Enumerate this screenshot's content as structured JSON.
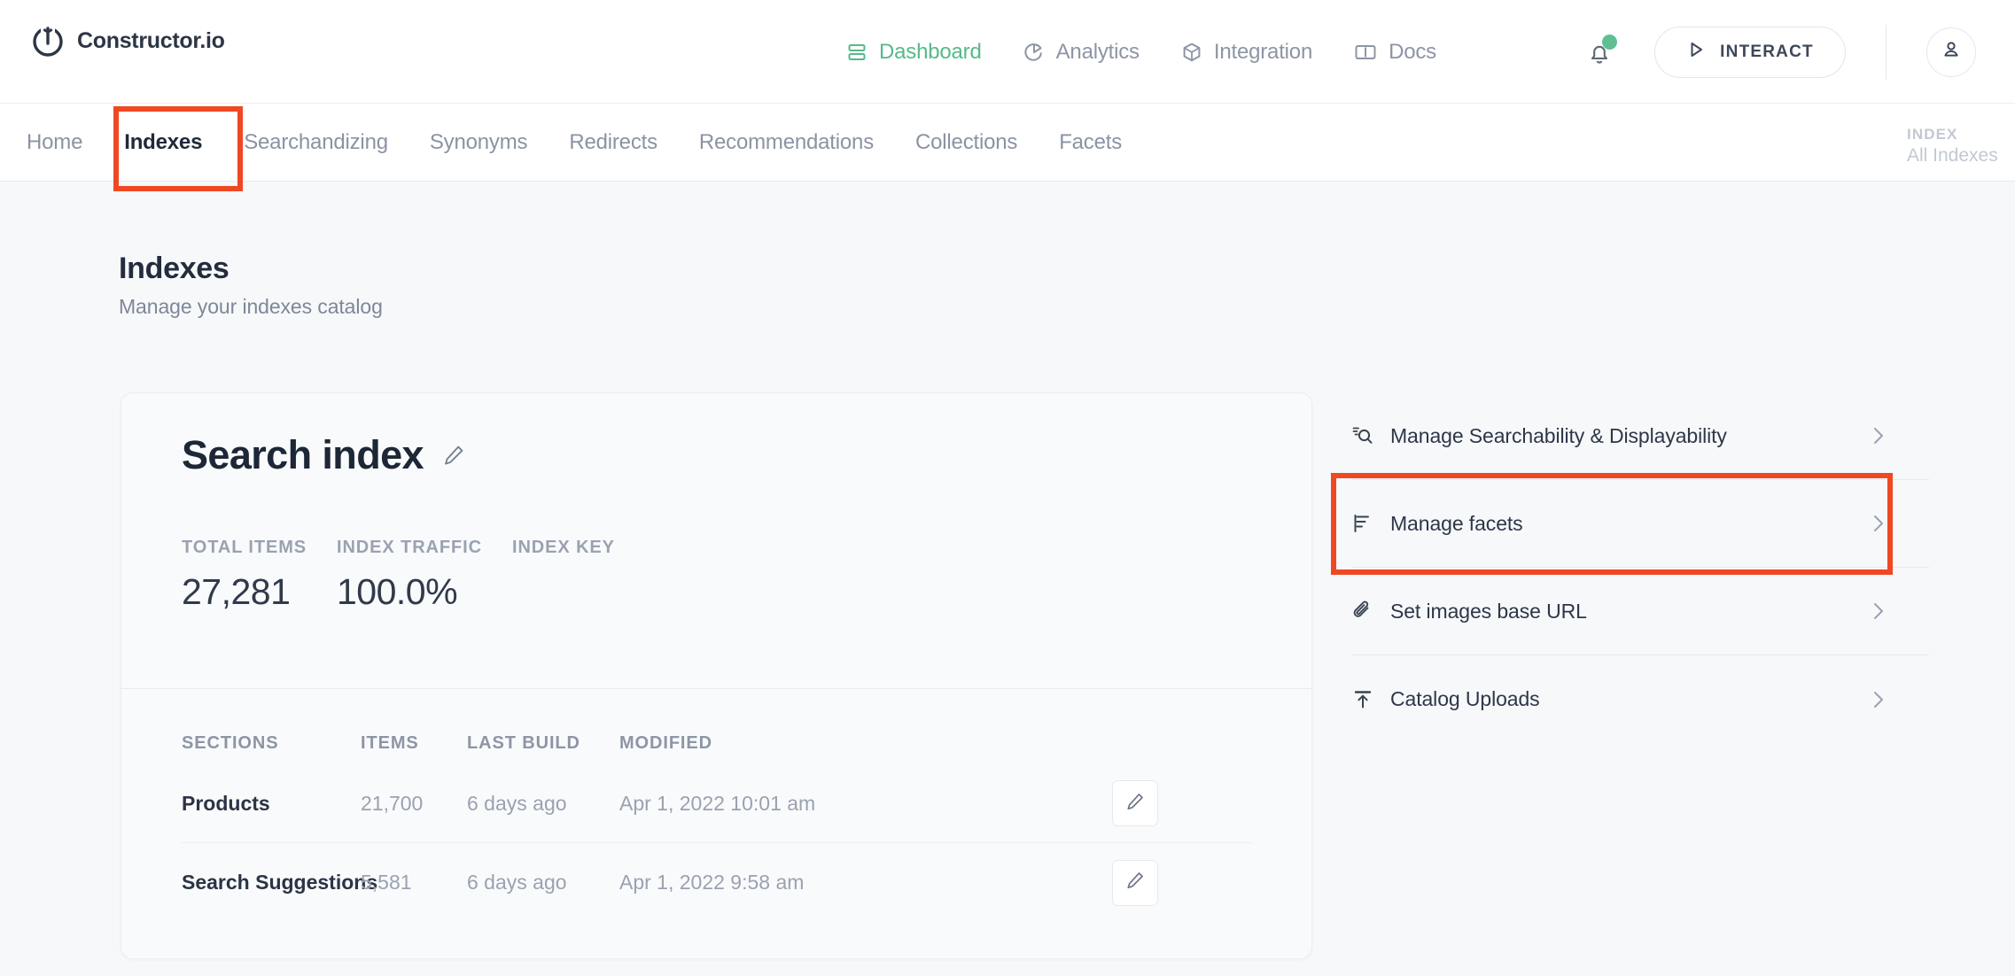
{
  "brand": {
    "name": "Constructor.io",
    "icon": "power-logo-icon"
  },
  "header": {
    "nav": [
      {
        "label": "Dashboard",
        "icon": "dashboard-icon",
        "active": true
      },
      {
        "label": "Analytics",
        "icon": "analytics-icon",
        "active": false
      },
      {
        "label": "Integration",
        "icon": "integration-icon",
        "active": false
      },
      {
        "label": "Docs",
        "icon": "docs-icon",
        "active": false
      }
    ],
    "notifications_icon": "bell-icon",
    "notifications_badge": true,
    "interact_button": {
      "label": "INTERACT",
      "icon": "play-icon"
    },
    "account_icon": "user-avatar-icon"
  },
  "subnav": {
    "items": [
      {
        "label": "Home",
        "active": false
      },
      {
        "label": "Indexes",
        "active": true
      },
      {
        "label": "Searchandizing",
        "active": false
      },
      {
        "label": "Synonyms",
        "active": false
      },
      {
        "label": "Redirects",
        "active": false
      },
      {
        "label": "Recommendations",
        "active": false
      },
      {
        "label": "Collections",
        "active": false
      },
      {
        "label": "Facets",
        "active": false
      }
    ],
    "scope_label": "INDEX",
    "scope_value": "All Indexes"
  },
  "page": {
    "title": "Indexes",
    "subtitle": "Manage your indexes catalog"
  },
  "index_card": {
    "title": "Search index",
    "edit_icon": "pencil-icon",
    "stats": [
      {
        "label": "TOTAL ITEMS",
        "value": "27,281"
      },
      {
        "label": "INDEX TRAFFIC",
        "value": "100.0%"
      },
      {
        "label": "INDEX KEY",
        "value": ""
      }
    ],
    "table": {
      "columns": [
        "SECTIONS",
        "ITEMS",
        "LAST BUILD",
        "MODIFIED"
      ],
      "rows": [
        {
          "section": "Products",
          "items": "21,700",
          "last_build": "6 days ago",
          "modified": "Apr 1, 2022 10:01 am",
          "edit_icon": "pencil-icon"
        },
        {
          "section": "Search Suggestions",
          "items": "5,581",
          "last_build": "6 days ago",
          "modified": "Apr 1, 2022 9:58 am",
          "edit_icon": "pencil-icon"
        }
      ]
    }
  },
  "actions": [
    {
      "label": "Manage Searchability & Displayability",
      "icon": "search-settings-icon",
      "chevron": "chevron-right-icon",
      "highlighted": false
    },
    {
      "label": "Manage facets",
      "icon": "facets-icon",
      "chevron": "chevron-right-icon",
      "highlighted": true
    },
    {
      "label": "Set images base URL",
      "icon": "paperclip-icon",
      "chevron": "chevron-right-icon",
      "highlighted": false
    },
    {
      "label": "Catalog Uploads",
      "icon": "upload-icon",
      "chevron": "chevron-right-icon",
      "highlighted": false
    }
  ],
  "annotations": [
    {
      "target": "subnav-item-indexes",
      "color": "#ef4823"
    },
    {
      "target": "action-manage-facets",
      "color": "#ef4823"
    }
  ],
  "colors": {
    "accent_green": "#55b98a",
    "annotation_red": "#ef4823",
    "text_primary": "#242d3d",
    "text_muted": "#8d95a5",
    "page_background": "#f7f8fa"
  }
}
